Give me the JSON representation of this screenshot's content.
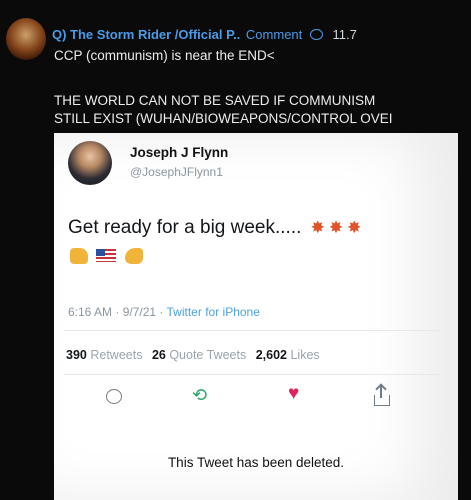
{
  "comment": {
    "author": "Q) The Storm Rider /Official P..",
    "comment_label": "Comment",
    "comment_count": "11.7",
    "line1": "CCP (communism) is near the END<",
    "line2": "THE WORLD CAN NOT BE SAVED IF COMMUNISM",
    "line3": "STILL EXIST (WUHAN/BIOWEAPONS/CONTROL OVEI"
  },
  "tweet": {
    "name": "Joseph J Flynn",
    "handle": "@JosephJFlynn1",
    "text": "Get ready for a big week.....",
    "emoji_stars": "✸✸✸",
    "time": "6:16 AM · 9/7/21 · ",
    "source": "Twitter for iPhone",
    "retweets": "390",
    "retweets_label": "Retweets",
    "quote_tweets": "26",
    "quote_tweets_label": "Quote Tweets",
    "likes": "2,602",
    "likes_label": "Likes",
    "deleted_notice": "This Tweet has been deleted.",
    "retweet_glyph": "⟲",
    "like_glyph": "♥"
  },
  "colors": {
    "background": "#0a0a0a",
    "author_link": "#4a9be8",
    "retweet_green": "#2aa86a",
    "like_red": "#e0245e"
  },
  "icons": [
    "comment-bubble-icon",
    "reply-icon",
    "retweet-icon",
    "like-icon",
    "share-icon"
  ]
}
